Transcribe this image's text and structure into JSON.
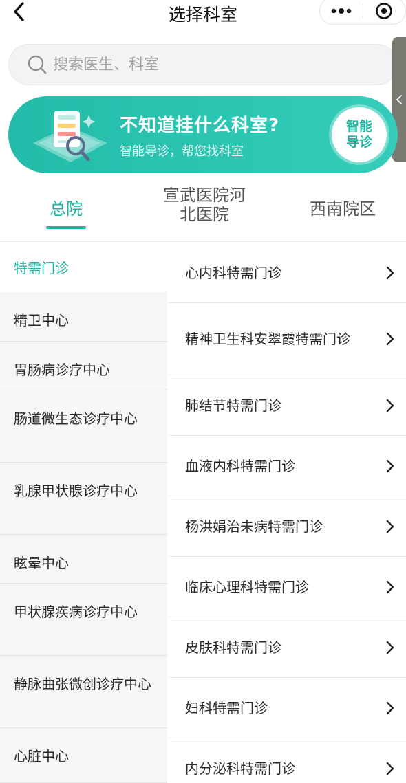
{
  "header": {
    "title": "选择科室",
    "back_icon": "chevron-left-icon",
    "more_icon": "more-dots-icon",
    "target_icon": "record-target-icon"
  },
  "search": {
    "placeholder": "搜索医生、科室",
    "icon": "search-icon"
  },
  "banner": {
    "title": "不知道挂什么科室?",
    "subtitle": "智能导诊，帮您找科室",
    "button_line1": "智能",
    "button_line2": "导诊",
    "bg_color": "#2cc7b3"
  },
  "campus_tabs": [
    {
      "line1": "总院",
      "line2": "",
      "active": true
    },
    {
      "line1": "宣武医院河",
      "line2": "北医院",
      "active": false
    },
    {
      "line1": "西南院区",
      "line2": "",
      "active": false
    }
  ],
  "left_menu": [
    {
      "label": "特需门诊",
      "active": true
    },
    {
      "label": "精卫中心"
    },
    {
      "label": "胃肠病诊疗中心"
    },
    {
      "label": "肠道微生态诊疗中心"
    },
    {
      "label": "乳腺甲状腺诊疗中心"
    },
    {
      "label": "眩晕中心"
    },
    {
      "label": "甲状腺疾病诊疗中心"
    },
    {
      "label": "静脉曲张微创诊疗中心"
    },
    {
      "label": "心脏中心"
    }
  ],
  "right_list": [
    {
      "label": "心内科特需门诊"
    },
    {
      "label": "精神卫生科安翠霞特需门诊"
    },
    {
      "label": "肺结节特需门诊"
    },
    {
      "label": "血液内科特需门诊"
    },
    {
      "label": "杨洪娟治未病特需门诊"
    },
    {
      "label": "临床心理科特需门诊"
    },
    {
      "label": "皮肤科特需门诊"
    },
    {
      "label": "妇科特需门诊"
    },
    {
      "label": "内分泌科特需门诊"
    }
  ],
  "colors": {
    "accent": "#1db5a1",
    "left_bg": "#f6f6f6"
  }
}
